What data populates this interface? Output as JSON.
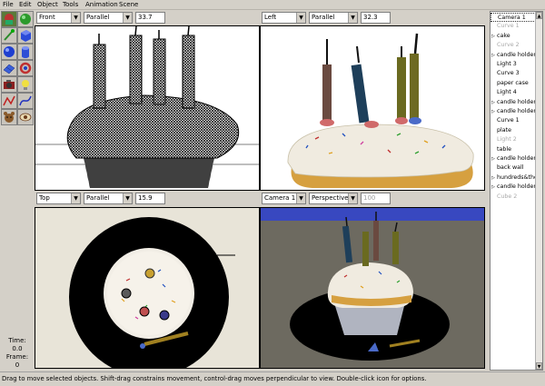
{
  "menu": {
    "items": [
      "File",
      "Edit",
      "Object",
      "Tools",
      "Animation",
      "Scene"
    ]
  },
  "toolbox": {
    "tools": [
      "cupcake-icon",
      "green-sphere-icon",
      "paint-brush-icon",
      "cube-icon",
      "blue-sphere-icon",
      "cylinder-icon",
      "mesh-icon",
      "torus-icon",
      "camera-icon",
      "light-bulb-icon",
      "spline-curve-icon",
      "smooth-curve-icon",
      "teddy-bear-icon",
      "eye-icon"
    ]
  },
  "viewports": {
    "top_left": {
      "view": "Front",
      "projection": "Parallel",
      "zoom": "33.7"
    },
    "top_right": {
      "view": "Left",
      "projection": "Parallel",
      "zoom": "32.3"
    },
    "bottom_left": {
      "view": "Top",
      "projection": "Parallel",
      "zoom": "15.9"
    },
    "bottom_right": {
      "view": "Camera 1",
      "projection": "Perspective",
      "zoom": "100"
    }
  },
  "status": {
    "time_label": "Time:",
    "time_value": "0.0",
    "frame_label": "Frame:",
    "frame_value": "0",
    "message": "Drag to move selected objects.  Shift-drag constrains movement, control-drag moves perpendicular to view.  Double-click icon for options."
  },
  "objects": [
    {
      "label": "Camera 1",
      "expandable": false,
      "dim": false,
      "selected": true
    },
    {
      "label": "Curve 1",
      "expandable": false,
      "dim": true,
      "selected": false
    },
    {
      "label": "cake",
      "expandable": true,
      "dim": false,
      "selected": false
    },
    {
      "label": "Curve 2",
      "expandable": false,
      "dim": true,
      "selected": false
    },
    {
      "label": "candle holder",
      "expandable": true,
      "dim": false,
      "selected": false
    },
    {
      "label": "Light 3",
      "expandable": false,
      "dim": false,
      "selected": false
    },
    {
      "label": "Curve 3",
      "expandable": false,
      "dim": false,
      "selected": false
    },
    {
      "label": "paper case",
      "expandable": false,
      "dim": false,
      "selected": false
    },
    {
      "label": "Light 4",
      "expandable": false,
      "dim": false,
      "selected": false
    },
    {
      "label": "candle holder",
      "expandable": true,
      "dim": false,
      "selected": false
    },
    {
      "label": "candle holder",
      "expandable": true,
      "dim": false,
      "selected": false
    },
    {
      "label": "Curve 1",
      "expandable": false,
      "dim": false,
      "selected": false
    },
    {
      "label": "plate",
      "expandable": false,
      "dim": false,
      "selected": false
    },
    {
      "label": "Light 2",
      "expandable": false,
      "dim": true,
      "selected": false
    },
    {
      "label": "table",
      "expandable": false,
      "dim": false,
      "selected": false
    },
    {
      "label": "candle holder",
      "expandable": true,
      "dim": false,
      "selected": false
    },
    {
      "label": "back wall",
      "expandable": false,
      "dim": false,
      "selected": false
    },
    {
      "label": "hundreds&thou",
      "expandable": true,
      "dim": false,
      "selected": false
    },
    {
      "label": "candle holder",
      "expandable": true,
      "dim": false,
      "selected": false
    },
    {
      "label": "Cube 2",
      "expandable": false,
      "dim": true,
      "selected": false
    }
  ]
}
